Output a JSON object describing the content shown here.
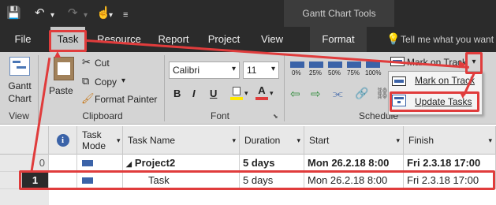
{
  "window": {
    "contextual_group": "Gantt Chart Tools"
  },
  "menu_tabs": [
    "File",
    "Task",
    "Resource",
    "Report",
    "Project",
    "View",
    "Format"
  ],
  "tell_me": "Tell me what you want",
  "ribbon": {
    "view_group": {
      "gantt_button": "Gantt",
      "gantt_button_line2": "Chart",
      "label": "View"
    },
    "clipboard": {
      "paste": "Paste",
      "cut": "Cut",
      "copy": "Copy",
      "format_painter": "Format Painter",
      "label": "Clipboard"
    },
    "font": {
      "family": "Calibri",
      "size": "11",
      "bold": "B",
      "italic": "I",
      "underline": "U",
      "label": "Font"
    },
    "schedule": {
      "percents": [
        "0%",
        "25%",
        "50%",
        "75%",
        "100%"
      ],
      "mark_on_track": "Mark on Track",
      "label": "Schedule",
      "dropdown": {
        "items": [
          "Mark on Track",
          "Update Tasks"
        ]
      }
    }
  },
  "grid": {
    "headers": [
      "Task Mode",
      "Task Name",
      "Duration",
      "Start",
      "Finish"
    ],
    "rows": [
      {
        "id": "0",
        "name": "Project2",
        "duration": "5 days",
        "start": "Mon 26.2.18 8:00",
        "finish": "Fri 2.3.18 17:00"
      },
      {
        "id": "1",
        "name": "Task",
        "duration": "5 days",
        "start": "Mon 26.2.18 8:00",
        "finish": "Fri 2.3.18 17:00"
      }
    ]
  },
  "colors": {
    "annotation": "#e03c3c",
    "title_bar": "#2b2b2b",
    "ribbon": "#d4d4d4"
  }
}
